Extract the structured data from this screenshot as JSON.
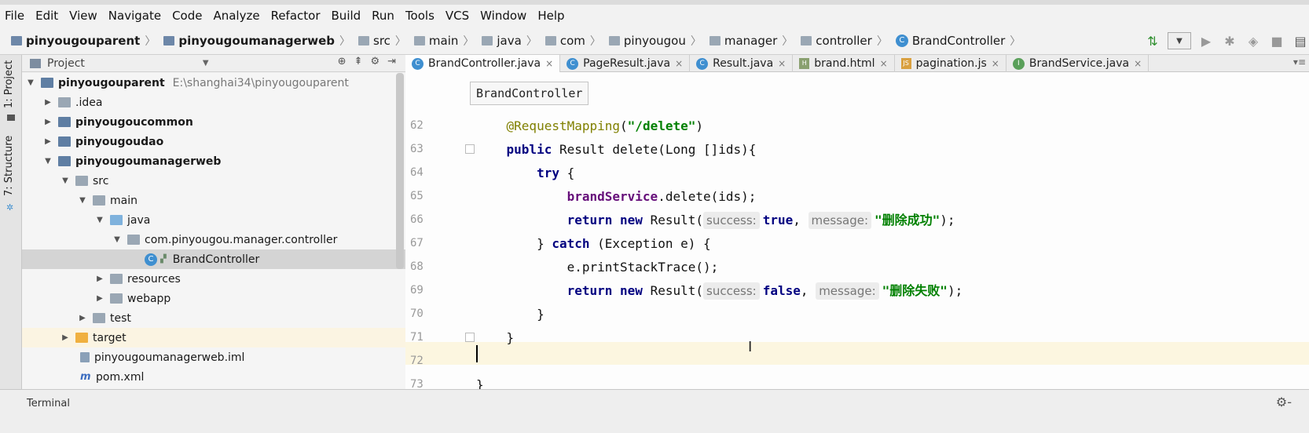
{
  "menu": [
    "File",
    "Edit",
    "View",
    "Navigate",
    "Code",
    "Analyze",
    "Refactor",
    "Build",
    "Run",
    "Tools",
    "VCS",
    "Window",
    "Help"
  ],
  "breadcrumb": [
    {
      "label": "pinyougouparent",
      "icon": "module-icon",
      "bold": true
    },
    {
      "label": "pinyougoumanagerweb",
      "icon": "module-icon",
      "bold": true
    },
    {
      "label": "src",
      "icon": "folder-icon"
    },
    {
      "label": "main",
      "icon": "folder-icon"
    },
    {
      "label": "java",
      "icon": "folder-icon"
    },
    {
      "label": "com",
      "icon": "folder-icon"
    },
    {
      "label": "pinyougou",
      "icon": "folder-icon"
    },
    {
      "label": "manager",
      "icon": "folder-icon"
    },
    {
      "label": "controller",
      "icon": "folder-icon"
    },
    {
      "label": "BrandController",
      "icon": "class-icon"
    }
  ],
  "sidebar": {
    "project_tab": "1: Project",
    "structure_tab": "7: Structure"
  },
  "project_panel": {
    "title": "Project"
  },
  "tree": [
    {
      "label": "pinyougouparent",
      "path": "E:\\shanghai34\\pinyougouparent",
      "bold": true,
      "icon": "module-folder-icon"
    },
    {
      "label": ".idea",
      "icon": "folder-icon"
    },
    {
      "label": "pinyougoucommon",
      "bold": true,
      "icon": "module-folder-icon"
    },
    {
      "label": "pinyougoudao",
      "bold": true,
      "icon": "module-folder-icon"
    },
    {
      "label": "pinyougoumanagerweb",
      "bold": true,
      "icon": "module-folder-icon"
    },
    {
      "label": "src",
      "icon": "folder-icon"
    },
    {
      "label": "main",
      "icon": "folder-icon"
    },
    {
      "label": "java",
      "icon": "source-folder-icon"
    },
    {
      "label": "com.pinyougou.manager.controller",
      "icon": "package-icon"
    },
    {
      "label": "BrandController",
      "icon": "class-icon"
    },
    {
      "label": "resources",
      "icon": "resources-folder-icon"
    },
    {
      "label": "webapp",
      "icon": "web-folder-icon"
    },
    {
      "label": "test",
      "icon": "folder-icon"
    },
    {
      "label": "target",
      "icon": "excluded-folder-icon"
    },
    {
      "label": "pinyougoumanagerweb.iml",
      "icon": "iml-file-icon"
    },
    {
      "label": "pom.xml",
      "icon": "maven-file-icon"
    }
  ],
  "tabs": [
    {
      "label": "BrandController.java",
      "icon": "class-icon",
      "active": true
    },
    {
      "label": "PageResult.java",
      "icon": "class-icon"
    },
    {
      "label": "Result.java",
      "icon": "class-icon"
    },
    {
      "label": "brand.html",
      "icon": "html-file-icon"
    },
    {
      "label": "pagination.js",
      "icon": "js-file-icon"
    },
    {
      "label": "BrandService.java",
      "icon": "interface-icon"
    }
  ],
  "editor": {
    "breadcrumb_popup": "BrandController",
    "line_numbers": [
      "62",
      "63",
      "64",
      "65",
      "66",
      "67",
      "68",
      "69",
      "70",
      "71",
      "72",
      "73"
    ],
    "code": {
      "l62": {
        "ann": "@RequestMapping",
        "open": "(",
        "str": "\"/delete\"",
        "close": ")"
      },
      "l63": {
        "kw": "public",
        "rest": " Result delete(Long []ids){"
      },
      "l64": {
        "kw": "try",
        "rest": " {"
      },
      "l65": {
        "field": "brandService",
        "rest": ".delete(ids);"
      },
      "l66": {
        "kw1": "return",
        "kw2": "new",
        "mid": " Result(",
        "hint1": "success:",
        "kw3": "true",
        "comma": ",",
        "hint2": "message:",
        "str": "\"删除成功\"",
        "end": ");"
      },
      "l67": {
        "pre": "} ",
        "kw": "catch",
        "rest": " (Exception e) {"
      },
      "l68": {
        "text": "e.printStackTrace();"
      },
      "l69": {
        "kw1": "return",
        "kw2": "new",
        "mid": " Result(",
        "hint1": "success:",
        "kw3": "false",
        "comma": ",",
        "hint2": "message:",
        "str": "\"删除失败\"",
        "end": ");"
      },
      "l70": {
        "text": "}"
      },
      "l71": {
        "text": "}"
      },
      "l73": {
        "text": "}"
      }
    }
  },
  "bottom": {
    "terminal": "Terminal"
  }
}
